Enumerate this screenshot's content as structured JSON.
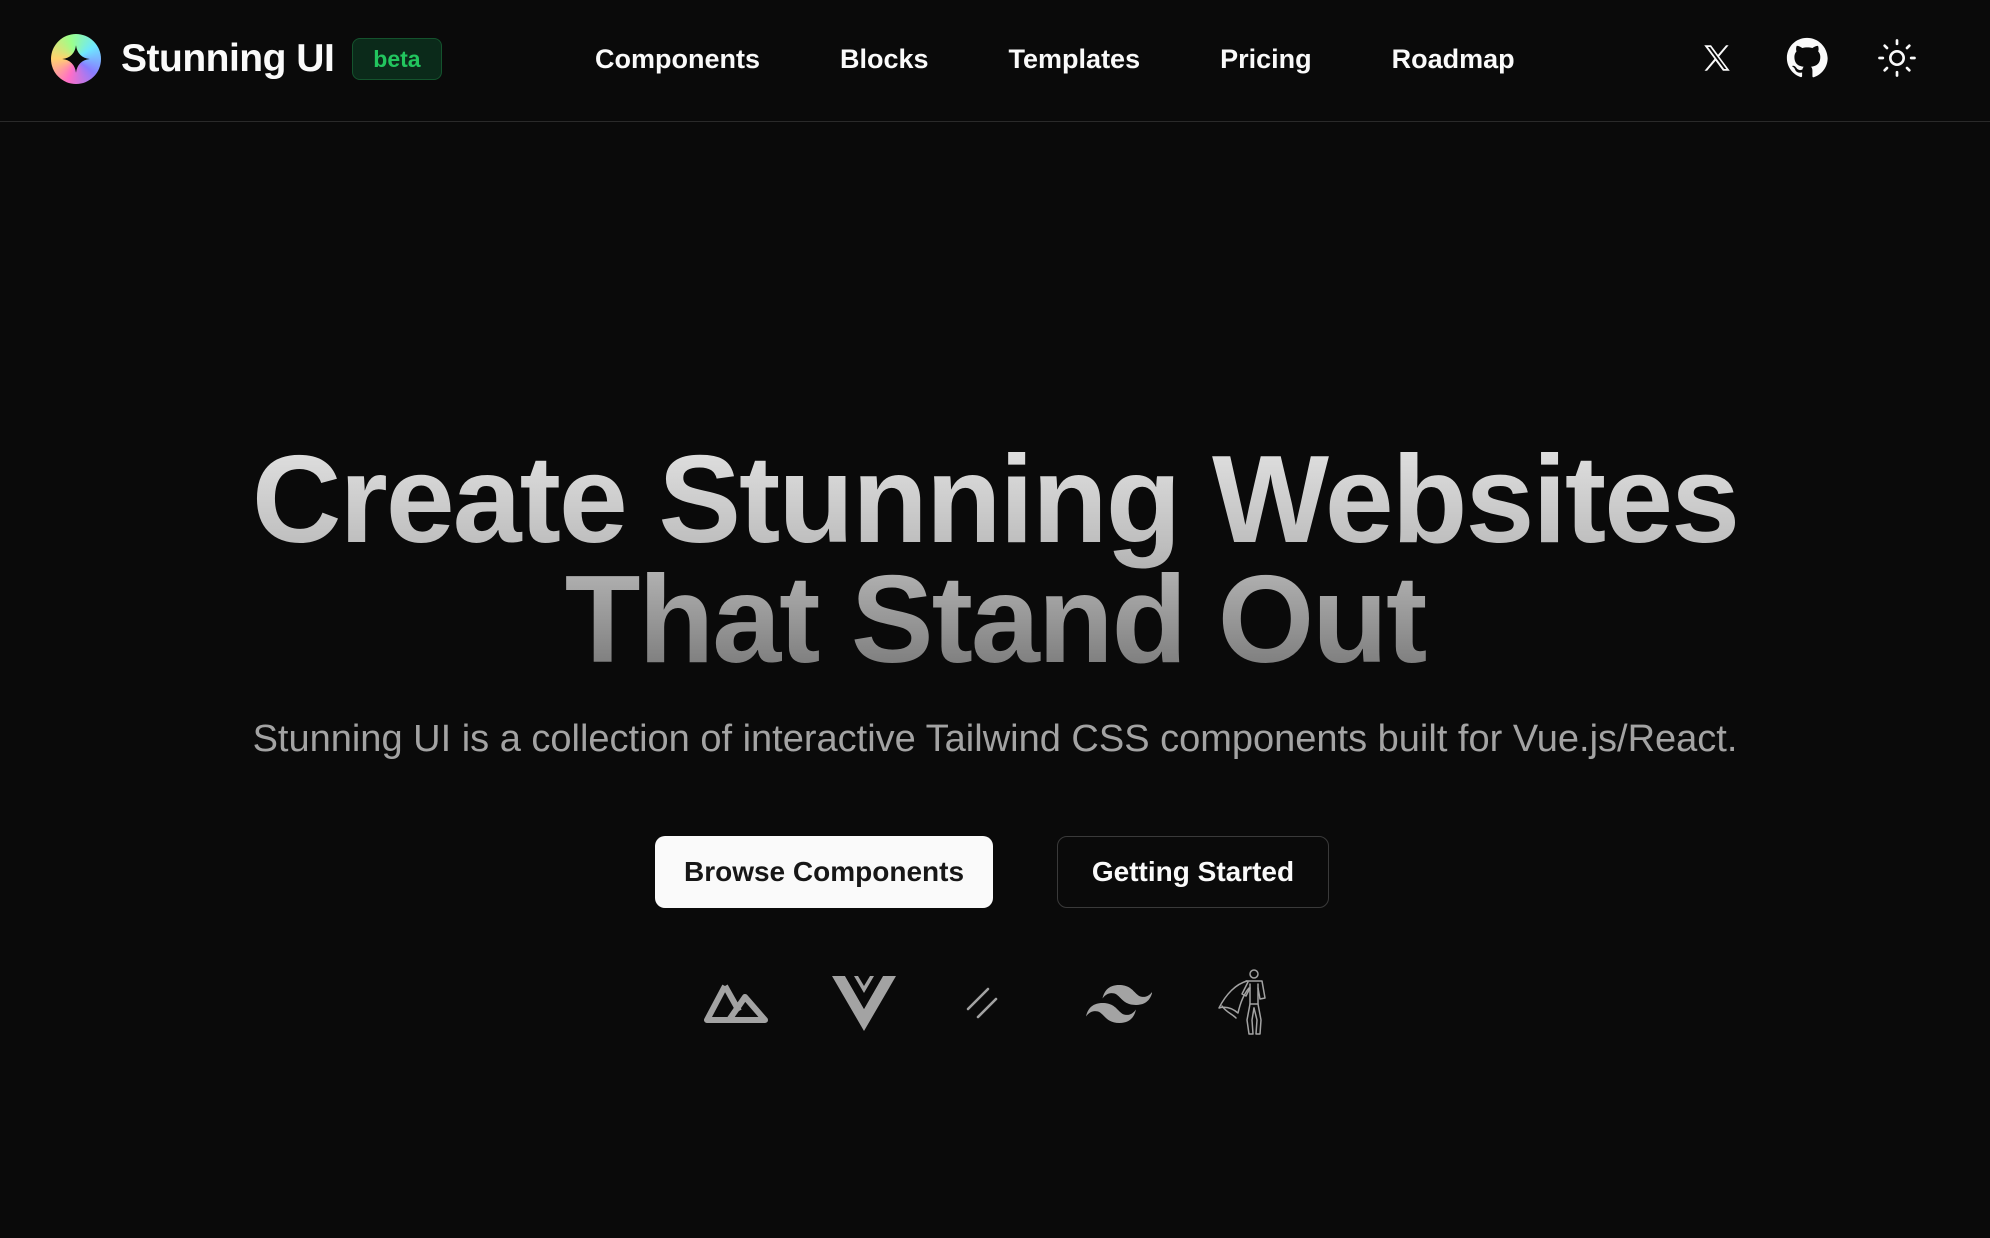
{
  "header": {
    "brand": {
      "name": "Stunning UI",
      "badge": "beta",
      "logo_icon": "sparkle-icon"
    },
    "nav": [
      {
        "label": "Components"
      },
      {
        "label": "Blocks"
      },
      {
        "label": "Templates"
      },
      {
        "label": "Pricing"
      },
      {
        "label": "Roadmap"
      }
    ],
    "actions": [
      {
        "icon": "x-twitter-icon"
      },
      {
        "icon": "github-icon"
      },
      {
        "icon": "sun-icon"
      }
    ]
  },
  "hero": {
    "title_line1": "Create Stunning Websites",
    "title_line2": "That Stand Out",
    "subtitle": "Stunning UI is a collection of interactive Tailwind CSS components built for Vue.js/React.",
    "primary_cta": "Browse Components",
    "secondary_cta": "Getting Started",
    "tech_icons": [
      "nuxt-icon",
      "vue-icon",
      "shadcn-icon",
      "tailwind-icon",
      "superhero-icon"
    ]
  },
  "colors": {
    "background": "#0a0a0a",
    "text": "#fafafa",
    "muted": "#a3a3a3",
    "badge_green": "#22c55e",
    "border": "#2a2a2a"
  }
}
